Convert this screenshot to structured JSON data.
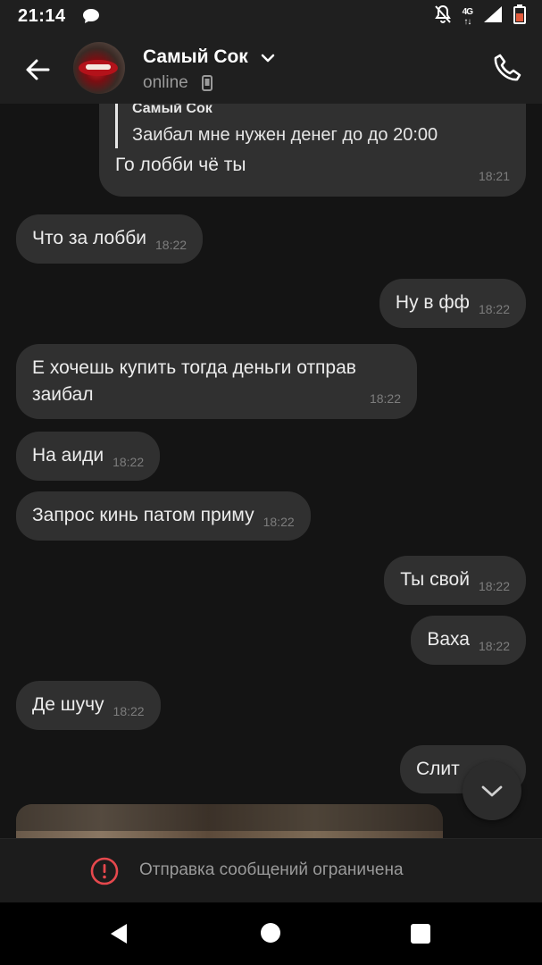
{
  "status_bar": {
    "time": "21:14",
    "network": "4G",
    "icons": [
      "chat-bubble-icon",
      "bell-off-icon",
      "signal-icon",
      "battery-icon"
    ]
  },
  "header": {
    "contact_name": "Самый Сок",
    "contact_status": "online",
    "icons": [
      "back-arrow-icon",
      "chevron-down-icon",
      "mobile-device-icon",
      "phone-call-icon"
    ]
  },
  "messages": [
    {
      "direction": "out",
      "reply_to": {
        "author": "Самый Сок",
        "text": "Заибал мне нужен денег до до 20:00"
      },
      "text": "Го лобби чё ты",
      "time": "18:21"
    },
    {
      "direction": "in",
      "text": "Что за лобби",
      "time": "18:22"
    },
    {
      "direction": "out",
      "text": "Ну в фф",
      "time": "18:22"
    },
    {
      "direction": "in",
      "text_lines": [
        "Е хочешь купить тогда деньги отправ",
        "заибал"
      ],
      "time": "18:22"
    },
    {
      "direction": "in",
      "text": "На аиди",
      "time": "18:22"
    },
    {
      "direction": "in",
      "text": "Запрос кинь патом приму",
      "time": "18:22"
    },
    {
      "direction": "out",
      "text": "Ты свой",
      "time": "18:22"
    },
    {
      "direction": "out",
      "text": "Ваха",
      "time": "18:22"
    },
    {
      "direction": "in",
      "text": "Де шучу",
      "time": "18:22"
    },
    {
      "direction": "out",
      "text": "Слит"
    }
  ],
  "restriction": {
    "text": "Отправка сообщений ограничена",
    "icon": "alert-circle-icon",
    "accent_color": "#e5484d"
  },
  "nav_bar": {
    "icons": [
      "nav-back-icon",
      "nav-home-icon",
      "nav-recent-icon"
    ]
  },
  "colors": {
    "background": "#141414",
    "bubble": "#303030",
    "header": "#1f1f1f"
  }
}
